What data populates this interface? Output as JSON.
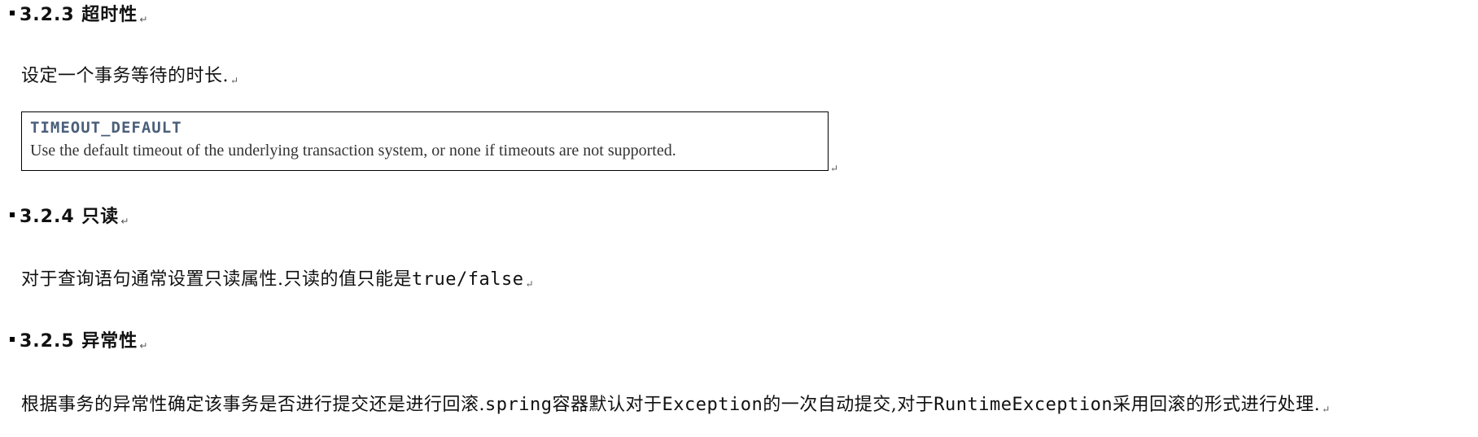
{
  "sections": [
    {
      "heading": "3.2.3 超时性",
      "paragraph": "设定一个事务等待的时长.",
      "code_box": {
        "constant": "TIMEOUT_DEFAULT",
        "description": "Use the default timeout of the underlying transaction system, or none if timeouts are not supported."
      }
    },
    {
      "heading": "3.2.4 只读",
      "paragraph_parts": {
        "text": "对于查询语句通常设置只读属性.只读的值只能是",
        "mono": "true/false"
      }
    },
    {
      "heading": "3.2.5 异常性",
      "paragraph_parts": {
        "t1": "根据事务的异常性确定该事务是否进行提交还是进行回滚.",
        "m1": "spring",
        "t2": "容器默认对于",
        "m2": "Exception",
        "t3": "的一次自动提交,对于",
        "m3": "RuntimeException",
        "t4": "采用回滚的形式进行处理."
      }
    }
  ],
  "paragraph_mark": "↵"
}
